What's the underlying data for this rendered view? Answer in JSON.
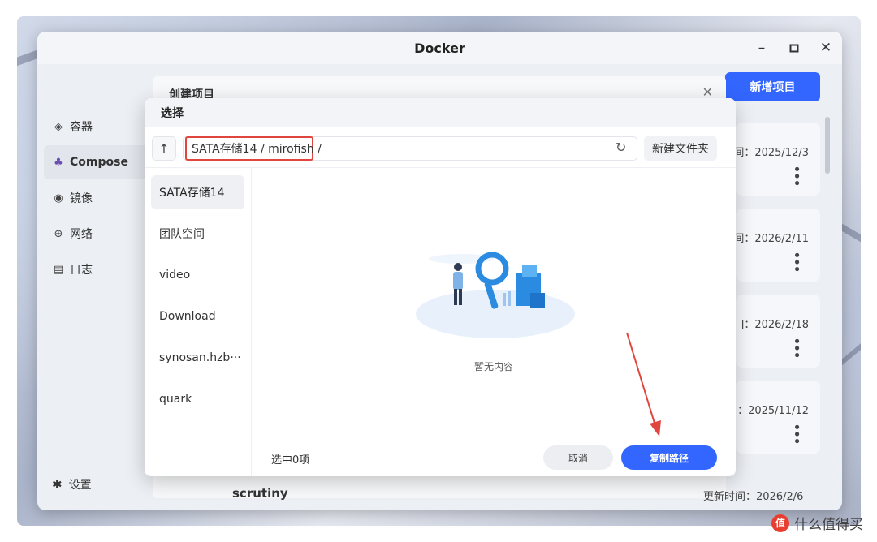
{
  "window": {
    "title": "Docker"
  },
  "sidebar": {
    "items": [
      {
        "label": "容器",
        "icon": "layers-icon"
      },
      {
        "label": "Compose",
        "icon": "compose-icon"
      },
      {
        "label": "镜像",
        "icon": "disc-icon"
      },
      {
        "label": "网络",
        "icon": "globe-icon"
      },
      {
        "label": "日志",
        "icon": "log-icon"
      }
    ],
    "active_index": 1,
    "settings_label": "设置"
  },
  "main": {
    "new_project_label": "新增项目",
    "create_panel_title": "创建项目",
    "cards": [
      {
        "date": "间：2025/12/3"
      },
      {
        "date": "间：2026/2/11"
      },
      {
        "date": "]：2026/2/18"
      },
      {
        "date": "：2025/11/12"
      }
    ],
    "bottom_row_name": "scrutiny",
    "bottom_row_date": "更新时间：2026/2/6"
  },
  "dialog": {
    "title": "选择",
    "path": "SATA存储14 / mirofish /",
    "new_folder_label": "新建文件夹",
    "directories": [
      "SATA存储14",
      "团队空间",
      "video",
      "Download",
      "synosan.hzb···",
      "quark"
    ],
    "active_directory_index": 0,
    "empty_text": "暂无内容",
    "selected_count": "选中0项",
    "cancel_label": "取消",
    "copy_path_label": "复制路径"
  },
  "watermark": {
    "badge": "值",
    "text": "什么值得买"
  },
  "colors": {
    "primary": "#3366ff",
    "highlight_border": "#e0463d",
    "arrow": "#e0463d"
  }
}
